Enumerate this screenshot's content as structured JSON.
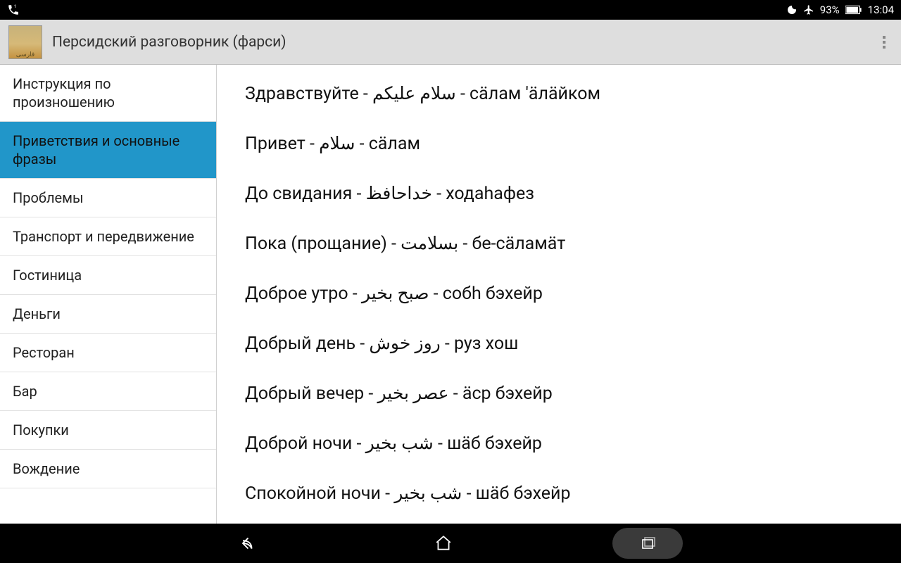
{
  "statusbar": {
    "battery": "93%",
    "time": "13:04"
  },
  "appbar": {
    "title": "Персидский разговорник (фарси)"
  },
  "sidebar": {
    "items": [
      {
        "label": "Инструкция по произношению",
        "active": false
      },
      {
        "label": "Приветствия и основные фразы",
        "active": true
      },
      {
        "label": "Проблемы",
        "active": false
      },
      {
        "label": "Транспорт и передвижение",
        "active": false
      },
      {
        "label": "Гостиница",
        "active": false
      },
      {
        "label": "Деньги",
        "active": false
      },
      {
        "label": "Ресторан",
        "active": false
      },
      {
        "label": "Бар",
        "active": false
      },
      {
        "label": "Покупки",
        "active": false
      },
      {
        "label": "Вождение",
        "active": false
      }
    ]
  },
  "content": {
    "phrases": [
      "Здравствуйте - سلام عليكم - сäлам 'äлäйком",
      "Привет - سلام - сäлам",
      "До свидания - خداحافظ - ходаhафез",
      "Пока (прощание) - بسلامت - бе-сäламäт",
      "Доброе утро - صبح بخير - собh бэхейр",
      "Добрый день - روز خوش - руз хош",
      "Добрый вечер - عصر بخير - äср бэхейр",
      "Доброй ночи - شب بخير - шäб бэхейр",
      "Спокойной ночи - شب بخير - шäб бэхейр"
    ]
  }
}
